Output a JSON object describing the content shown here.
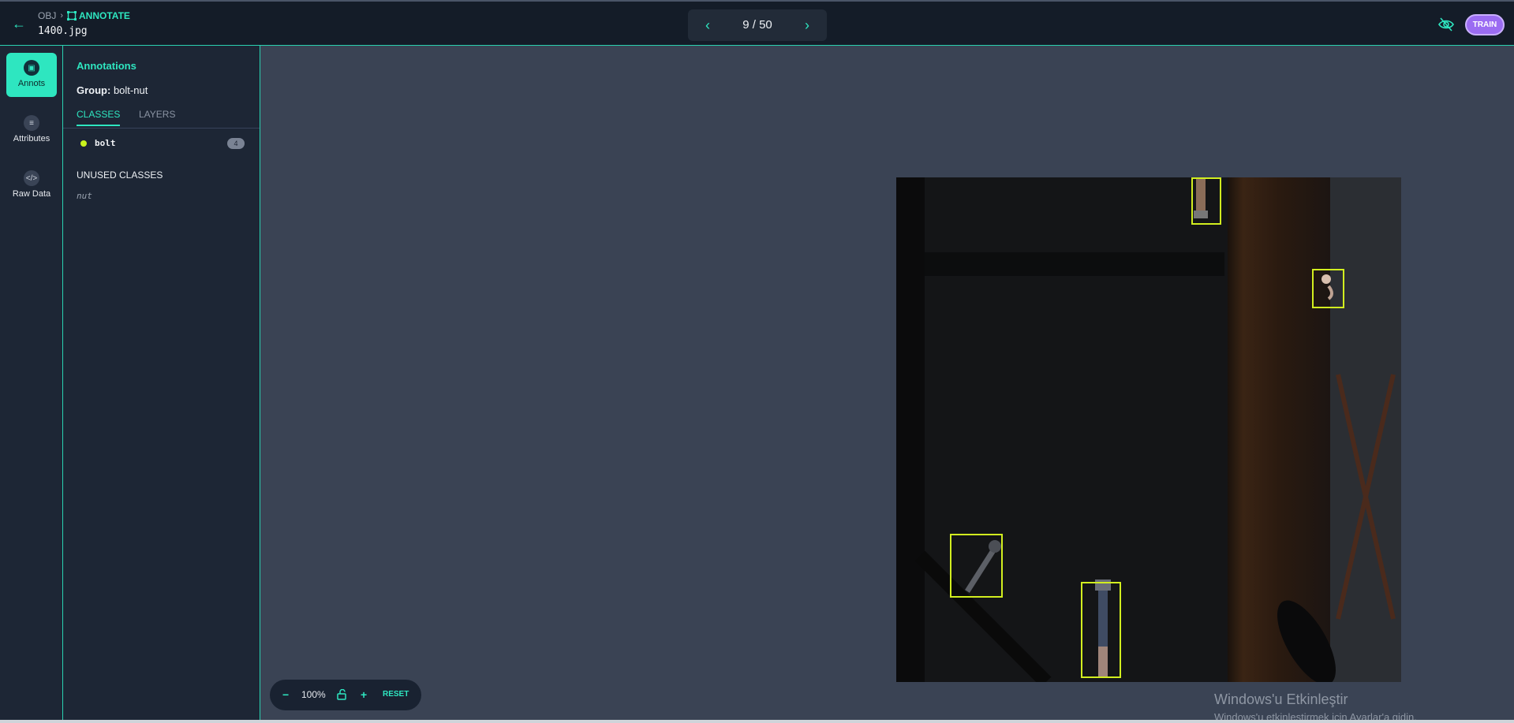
{
  "header": {
    "breadcrumb_root": "OBJ",
    "breadcrumb_current": "ANNOTATE",
    "filename": "1400.jpg",
    "pager": {
      "counter": "9 / 50"
    },
    "train_label": "TRAIN"
  },
  "nav": [
    {
      "label": "Annots",
      "icon": "annotation-icon",
      "active": true
    },
    {
      "label": "Attributes",
      "icon": "list-icon",
      "active": false
    },
    {
      "label": "Raw Data",
      "icon": "code-icon",
      "active": false
    }
  ],
  "panel": {
    "title": "Annotations",
    "group_label": "Group:",
    "group_value": "bolt-nut",
    "tabs": [
      "CLASSES",
      "LAYERS"
    ],
    "classes": [
      {
        "name": "bolt",
        "count": "4",
        "color": "#c9f31d"
      }
    ],
    "unused_title": "UNUSED CLASSES",
    "unused": [
      "nut"
    ]
  },
  "image": {
    "annotations": [
      {
        "class": "bolt"
      },
      {
        "class": "bolt"
      },
      {
        "class": "bolt"
      },
      {
        "class": "bolt"
      }
    ]
  },
  "zoom": {
    "level": "100%",
    "reset_label": "RESET"
  },
  "watermark": {
    "line1": "Windows'u Etkinleştir",
    "line2": "Windows'u etkinleştirmek için Ayarlar'a gidin."
  },
  "colors": {
    "accent": "#2ee6c0",
    "bbox": "#d2ee1f",
    "train": "#9b6cf2"
  }
}
